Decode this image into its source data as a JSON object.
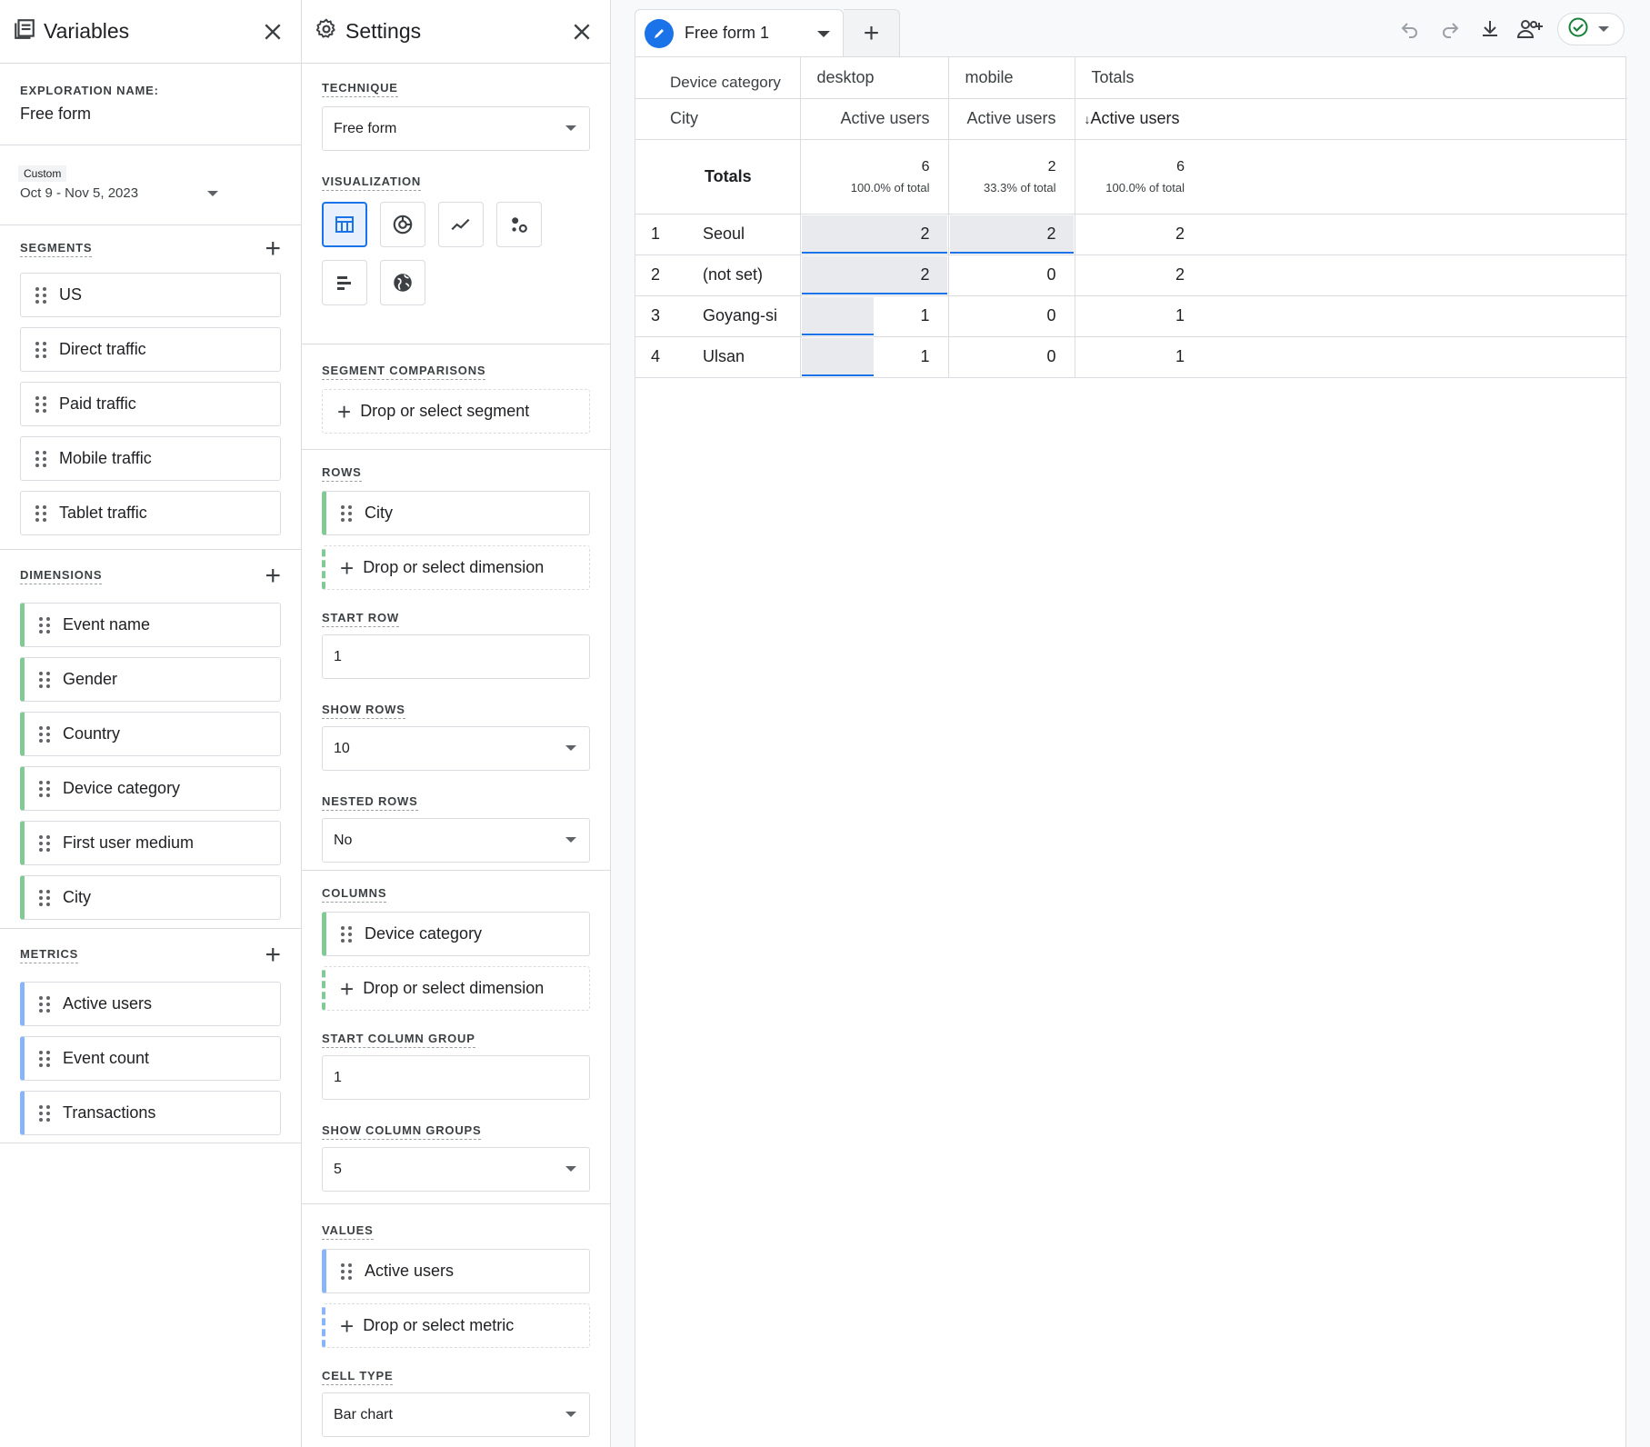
{
  "variables": {
    "title": "Variables",
    "exploration_label": "EXPLORATION NAME:",
    "exploration_name": "Free form",
    "date_badge": "Custom",
    "date_range": "Oct 9 - Nov 5, 2023",
    "segments_label": "SEGMENTS",
    "segments": [
      "US",
      "Direct traffic",
      "Paid traffic",
      "Mobile traffic",
      "Tablet traffic"
    ],
    "dimensions_label": "DIMENSIONS",
    "dimensions": [
      "Event name",
      "Gender",
      "Country",
      "Device category",
      "First user medium",
      "City"
    ],
    "metrics_label": "METRICS",
    "metrics": [
      "Active users",
      "Event count",
      "Transactions"
    ]
  },
  "settings": {
    "title": "Settings",
    "technique_label": "TECHNIQUE",
    "technique_value": "Free form",
    "visualization_label": "VISUALIZATION",
    "visualizations": [
      "table-icon",
      "donut-chart-icon",
      "line-chart-icon",
      "scatter-plot-icon",
      "bar-chart-icon",
      "geo-map-icon"
    ],
    "segment_comparisons_label": "SEGMENT COMPARISONS",
    "drop_segment": "Drop or select segment",
    "rows_label": "ROWS",
    "rows_item": "City",
    "drop_dimension": "Drop or select dimension",
    "start_row_label": "START ROW",
    "start_row_value": "1",
    "show_rows_label": "SHOW ROWS",
    "show_rows_value": "10",
    "nested_rows_label": "NESTED ROWS",
    "nested_rows_value": "No",
    "columns_label": "COLUMNS",
    "columns_item": "Device category",
    "start_column_group_label": "START COLUMN GROUP",
    "start_column_group_value": "1",
    "show_column_groups_label": "SHOW COLUMN GROUPS",
    "show_column_groups_value": "5",
    "values_label": "VALUES",
    "values_item": "Active users",
    "drop_metric": "Drop or select metric",
    "cell_type_label": "CELL TYPE",
    "cell_type_value": "Bar chart"
  },
  "tab": {
    "label": "Free form 1"
  },
  "table": {
    "col_dimension_label": "Device category",
    "col_groups": [
      "desktop",
      "mobile",
      "Totals"
    ],
    "row_dimension_label": "City",
    "metric_headers": [
      "Active users",
      "Active users",
      "Active users"
    ],
    "sort_arrow": "↓",
    "totals_label": "Totals",
    "totals": [
      {
        "value": "6",
        "pct": "100.0% of total"
      },
      {
        "value": "2",
        "pct": "33.3% of total"
      },
      {
        "value": "6",
        "pct": "100.0% of total"
      }
    ],
    "rows": [
      {
        "idx": "1",
        "city": "Seoul",
        "desktop": "2",
        "mobile": "2",
        "total": "2",
        "desktop_frac": 1.0,
        "mobile_frac": 1.0
      },
      {
        "idx": "2",
        "city": "(not set)",
        "desktop": "2",
        "mobile": "0",
        "total": "2",
        "desktop_frac": 1.0,
        "mobile_frac": 0
      },
      {
        "idx": "3",
        "city": "Goyang-si",
        "desktop": "1",
        "mobile": "0",
        "total": "1",
        "desktop_frac": 0.5,
        "mobile_frac": 0
      },
      {
        "idx": "4",
        "city": "Ulsan",
        "desktop": "1",
        "mobile": "0",
        "total": "1",
        "desktop_frac": 0.5,
        "mobile_frac": 0
      }
    ]
  },
  "colors": {
    "accent": "#1a73e8",
    "dimension_chip": "#81c995",
    "metric_chip": "#8ab4f8",
    "success": "#188038"
  }
}
